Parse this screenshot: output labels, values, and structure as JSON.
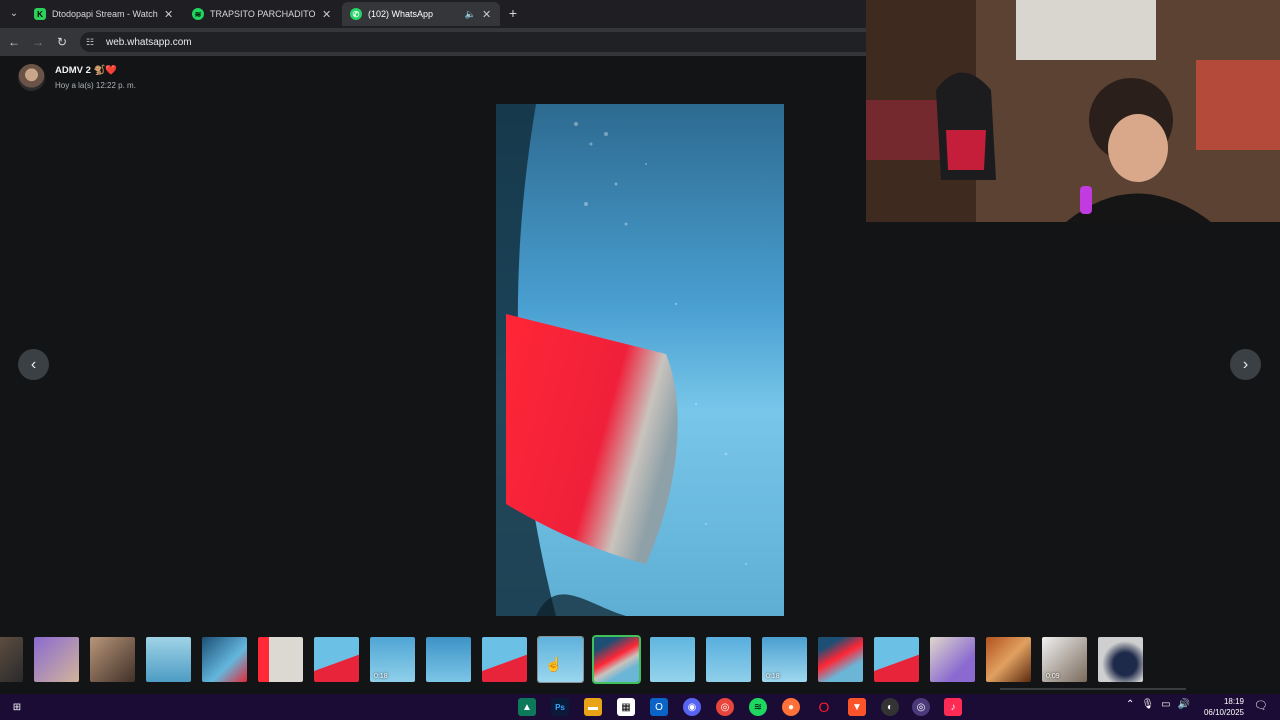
{
  "browser": {
    "tabs": [
      {
        "title": "Dtodopapi Stream - Watch Live",
        "favicon": "kick-icon",
        "active": false
      },
      {
        "title": "TRAPSITO PARCHADITO - playlist",
        "favicon": "spotify-icon",
        "active": false
      },
      {
        "title": "(102) WhatsApp",
        "favicon": "whatsapp-icon",
        "active": true
      }
    ],
    "url": "web.whatsapp.com"
  },
  "viewer": {
    "sender_name": "ADMV 2 🐒❤️",
    "timestamp": "Hoy a la(s) 12:22 p. m."
  },
  "thumbnails": [
    {
      "kind": "photo",
      "duration": ""
    },
    {
      "kind": "photo",
      "duration": ""
    },
    {
      "kind": "photo",
      "duration": ""
    },
    {
      "kind": "photo",
      "duration": ""
    },
    {
      "kind": "photo",
      "duration": ""
    },
    {
      "kind": "photo",
      "duration": ""
    },
    {
      "kind": "photo",
      "duration": ""
    },
    {
      "kind": "video",
      "duration": "0:18"
    },
    {
      "kind": "photo",
      "duration": ""
    },
    {
      "kind": "photo",
      "duration": ""
    },
    {
      "kind": "photo",
      "duration": "",
      "hover": true
    },
    {
      "kind": "photo",
      "duration": "",
      "current": true
    },
    {
      "kind": "photo",
      "duration": ""
    },
    {
      "kind": "photo",
      "duration": ""
    },
    {
      "kind": "video",
      "duration": "0:18"
    },
    {
      "kind": "photo",
      "duration": ""
    },
    {
      "kind": "photo",
      "duration": ""
    },
    {
      "kind": "photo",
      "duration": ""
    },
    {
      "kind": "photo",
      "duration": ""
    },
    {
      "kind": "video",
      "duration": "0:09"
    },
    {
      "kind": "photo",
      "duration": ""
    }
  ],
  "taskbar": {
    "time": "18:19",
    "date": "06/10/2025"
  },
  "colors": {
    "viewer_bg": "#131416",
    "current_thumb_border": "#3fc25b",
    "taskbar_bg": "#1b0c35"
  }
}
